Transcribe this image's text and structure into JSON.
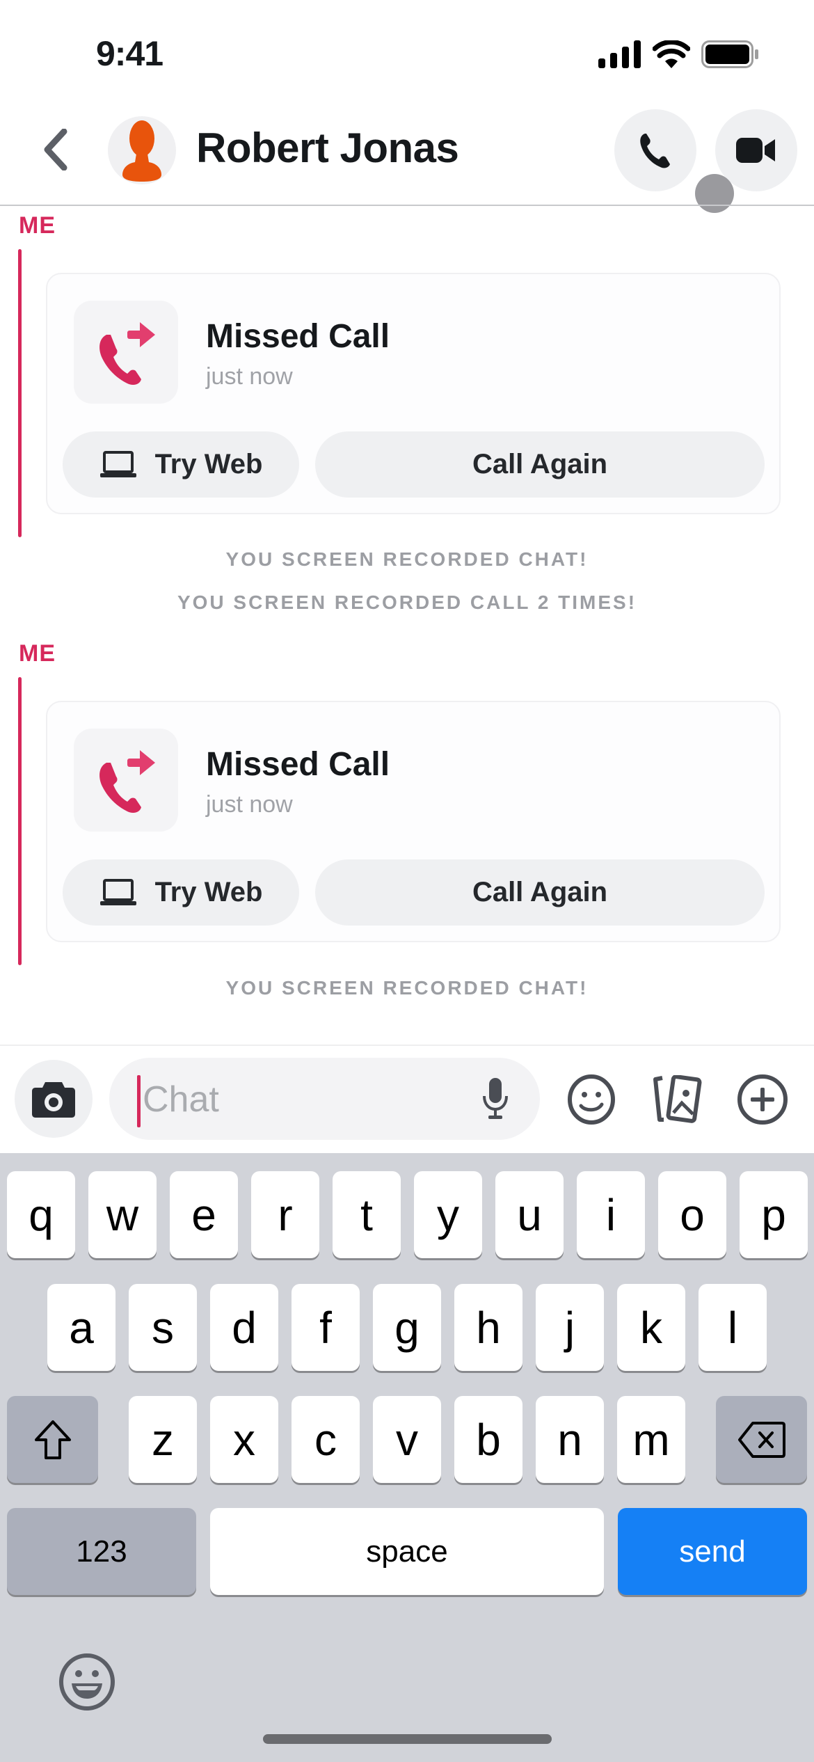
{
  "status_bar": {
    "time": "9:41"
  },
  "header": {
    "contact_name": "Robert Jonas",
    "back_icon": "chevron-left-icon",
    "call_icon": "phone-icon",
    "video_icon": "video-camera-icon"
  },
  "messages": [
    {
      "sender": "ME",
      "type": "missed_call",
      "title": "Missed Call",
      "time": "just now",
      "try_web_label": "Try Web",
      "call_again_label": "Call Again"
    },
    {
      "sender": "ME",
      "type": "missed_call",
      "title": "Missed Call",
      "time": "just now",
      "try_web_label": "Try Web",
      "call_again_label": "Call Again"
    }
  ],
  "system_messages": [
    "YOU SCREEN RECORDED CHAT!",
    "YOU SCREEN RECORDED CALL 2 TIMES!",
    "YOU SCREEN RECORDED CHAT!"
  ],
  "input_bar": {
    "placeholder": "Chat",
    "value": ""
  },
  "keyboard": {
    "row1": [
      "q",
      "w",
      "e",
      "r",
      "t",
      "y",
      "u",
      "i",
      "o",
      "p"
    ],
    "row2": [
      "a",
      "s",
      "d",
      "f",
      "g",
      "h",
      "j",
      "k",
      "l"
    ],
    "row3": [
      "z",
      "x",
      "c",
      "v",
      "b",
      "n",
      "m"
    ],
    "numbers_label": "123",
    "space_label": "space",
    "send_label": "send"
  },
  "colors": {
    "accent": "#d6285b",
    "send_blue": "#1580f5",
    "avatar_orange": "#e8540c"
  }
}
